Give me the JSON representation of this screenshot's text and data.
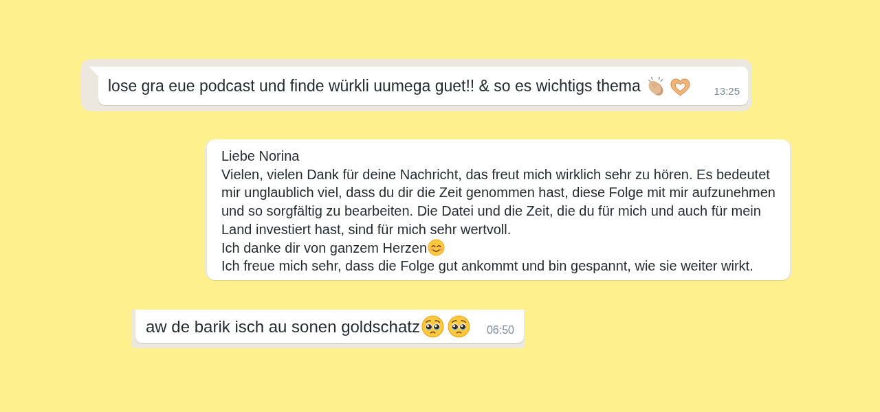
{
  "messages": [
    {
      "tail": true,
      "text": "lose gra eue podcast und finde würkli uumega guet!! & so es wichtigs thema",
      "emojis": [
        {
          "kind": "clapping-hands"
        },
        {
          "kind": "heart-hands"
        }
      ],
      "time": "13:25"
    },
    {
      "tail": false,
      "paragraphs": [
        {
          "text": "Liebe Norina"
        },
        {
          "text": "Vielen, vielen Dank für deine Nachricht, das freut mich wirklich sehr zu hören. Es bedeutet mir unglaublich viel, dass du dir die Zeit genommen hast, diese Folge mit mir aufzunehmen und so sorgfältig zu bearbeiten. Die Datei und die Zeit, die du für mich und auch für mein Land investiert hast, sind für mich sehr wertvoll."
        },
        {
          "text": "Ich danke dir von ganzem Herzen",
          "emojis": [
            {
              "kind": "smiling-face"
            }
          ]
        },
        {
          "text": "Ich freue mich sehr, dass die Folge gut ankommt und bin gespannt, wie sie weiter wirkt."
        }
      ]
    },
    {
      "tail": false,
      "text": "aw de barik isch au sonen goldschatz",
      "emojis": [
        {
          "kind": "pleading-face"
        },
        {
          "kind": "pleading-face"
        }
      ],
      "time": "06:50"
    }
  ]
}
